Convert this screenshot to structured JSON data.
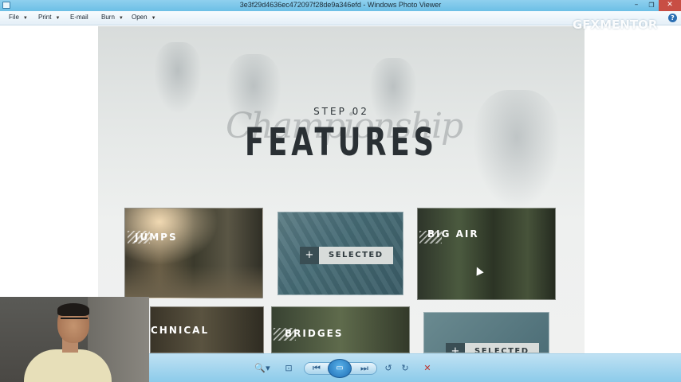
{
  "window": {
    "title": "3e3f29d4636ec472097f28de9a346efd - Windows Photo Viewer",
    "min_glyph": "–",
    "max_glyph": "❐",
    "close_glyph": "✕"
  },
  "menu": {
    "file": "File",
    "print": "Print",
    "email": "E-mail",
    "burn": "Burn",
    "open": "Open",
    "caret": "▼",
    "help_glyph": "?"
  },
  "watermark": {
    "logo": "GFXMENTOR"
  },
  "photo": {
    "script_word": "Championship",
    "step": "STEP 02",
    "title": "FEATURES",
    "cards": {
      "jumps": "JUMPS",
      "big_air": "BIG AIR",
      "technical": "CHNICAL",
      "bridges": "BRIDGES"
    },
    "selected_plus": "+",
    "selected_label": "SELECTED"
  },
  "toolbar": {
    "zoom_glyph": "🔍▾",
    "fit_glyph": "⊡",
    "prev_glyph": "⏮",
    "play_glyph": "▭",
    "next_glyph": "⏭",
    "rotate_left_glyph": "↺",
    "rotate_right_glyph": "↻",
    "delete_glyph": "✕"
  },
  "colors": {
    "titlebar": "#6cbfe6",
    "toolbar": "#8ccbea",
    "close_button": "#c84e44",
    "delete_icon": "#c0322b"
  }
}
